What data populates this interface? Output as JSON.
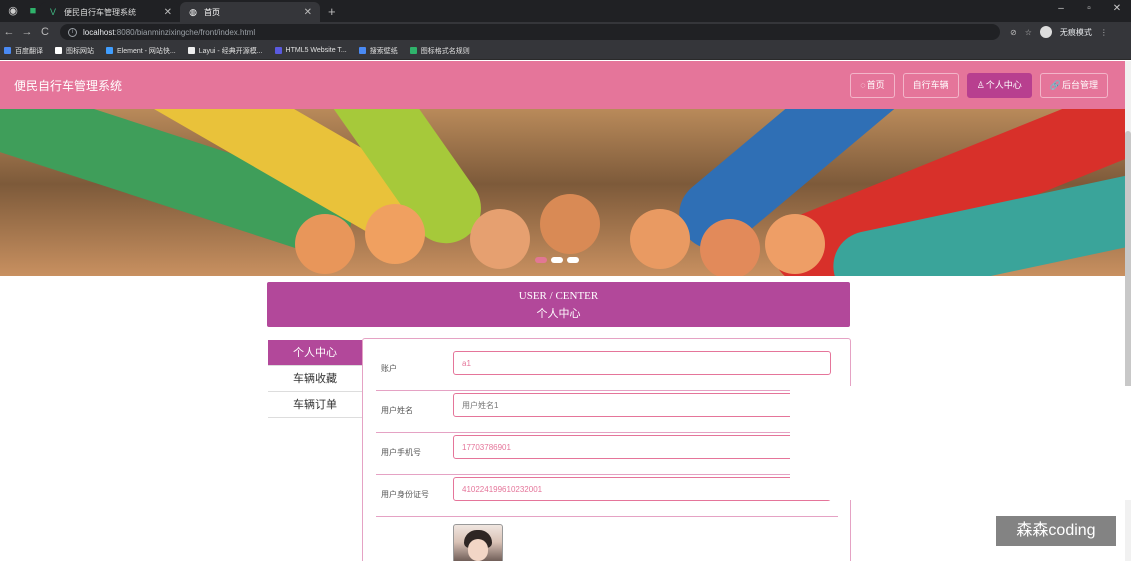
{
  "browser": {
    "tabs": [
      {
        "title": "便民自行车管理系统",
        "active": false
      },
      {
        "title": "首页",
        "active": true
      }
    ],
    "new_tab": "+",
    "window_controls": [
      "–",
      "▫",
      "✕"
    ],
    "url_host": "localhost",
    "url_path": ":8080/bianminzixingche/front/index.html",
    "incognito_label": "无痕模式",
    "bookmarks": [
      {
        "label": "百度翻译",
        "color": "#4a8af4"
      },
      {
        "label": "图标网站",
        "color": "#ffffff"
      },
      {
        "label": "Element - 网站快...",
        "color": "#409eff"
      },
      {
        "label": "Layui - 经典开源模...",
        "color": "#eeeeee"
      },
      {
        "label": "HTML5 Website T...",
        "color": "#5a5adf"
      },
      {
        "label": "搜索壁纸",
        "color": "#4a8af4"
      },
      {
        "label": "图标格式名规则",
        "color": "#2fb36b"
      }
    ]
  },
  "site": {
    "title": "便民自行车管理系统",
    "nav": [
      {
        "icon": "◌",
        "label": "首页",
        "active": false
      },
      {
        "icon": "",
        "label": "自行车辆",
        "active": false
      },
      {
        "icon": "♙",
        "label": "个人中心",
        "active": true
      },
      {
        "icon": "🔗",
        "label": "后台管理",
        "active": false
      }
    ],
    "colors": {
      "primary": "#e5759a",
      "accent": "#b2489a"
    }
  },
  "user_center": {
    "title_en": "USER / CENTER",
    "title_cn": "个人中心",
    "menu": [
      {
        "label": "个人中心",
        "active": true
      },
      {
        "label": "车辆收藏",
        "active": false
      },
      {
        "label": "车辆订单",
        "active": false
      }
    ],
    "fields": [
      {
        "label": "账户",
        "value": "a1",
        "placeholder": ""
      },
      {
        "label": "用户姓名",
        "value": "",
        "placeholder": "用户姓名1"
      },
      {
        "label": "用户手机号",
        "value": "17703786901",
        "placeholder": ""
      },
      {
        "label": "用户身份证号",
        "value": "410224199610232001",
        "placeholder": ""
      }
    ]
  },
  "watermark": "森森coding"
}
